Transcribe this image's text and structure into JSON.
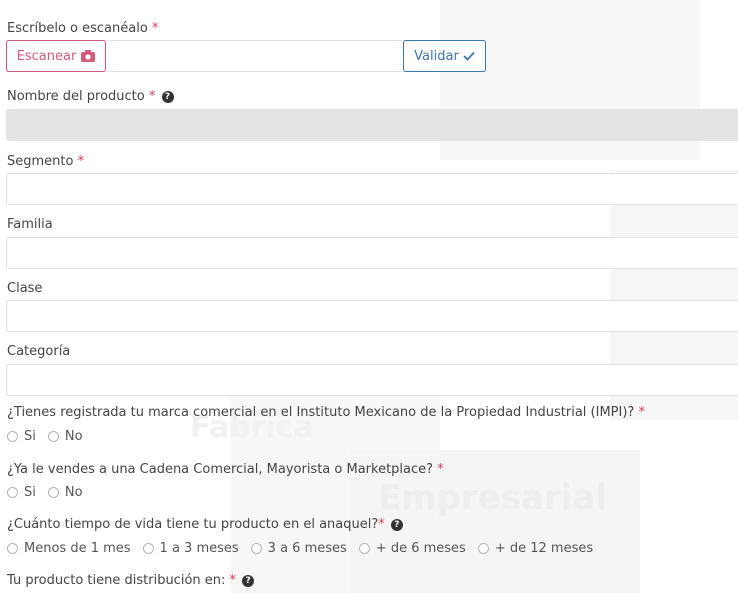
{
  "watermark": {
    "line1": "Fábrica",
    "line2": "Empresarial"
  },
  "scan": {
    "label": "Escríbelo o escanéalo",
    "required": "*",
    "scan_button": "Escanear",
    "validate_button": "Validar"
  },
  "fields": {
    "product_name": {
      "label": "Nombre del producto",
      "required": "*",
      "help": "?",
      "value": ""
    },
    "segment": {
      "label": "Segmento",
      "required": "*",
      "value": ""
    },
    "family": {
      "label": "Familia",
      "value": ""
    },
    "class": {
      "label": "Clase",
      "value": ""
    },
    "category": {
      "label": "Categoría",
      "value": ""
    }
  },
  "questions": {
    "impi": {
      "label": "¿Tienes registrada tu marca comercial en el Instituto Mexicano de la Propiedad Industrial (IMPI)?",
      "required": "*",
      "options": [
        "Si",
        "No"
      ]
    },
    "chain": {
      "label": "¿Ya le vendes a una Cadena Comercial, Mayorista o Marketplace?",
      "required": "*",
      "options": [
        "Si",
        "No"
      ]
    },
    "shelf_life": {
      "label": "¿Cuánto tiempo de vida tiene tu producto en el anaquel?",
      "required": "*",
      "help": "?",
      "options": [
        "Menos de 1 mes",
        "1 a 3 meses",
        "3 a 6 meses",
        "+ de 6 meses",
        "+ de 12 meses"
      ]
    },
    "distribution": {
      "label": "Tu producto tiene distribución en:",
      "required": "*",
      "help": "?"
    }
  },
  "colors": {
    "required": "#e23b58",
    "scan_accent": "#d7587a",
    "validate_accent": "#3a76b8",
    "disabled_field": "#e4e4e4"
  }
}
